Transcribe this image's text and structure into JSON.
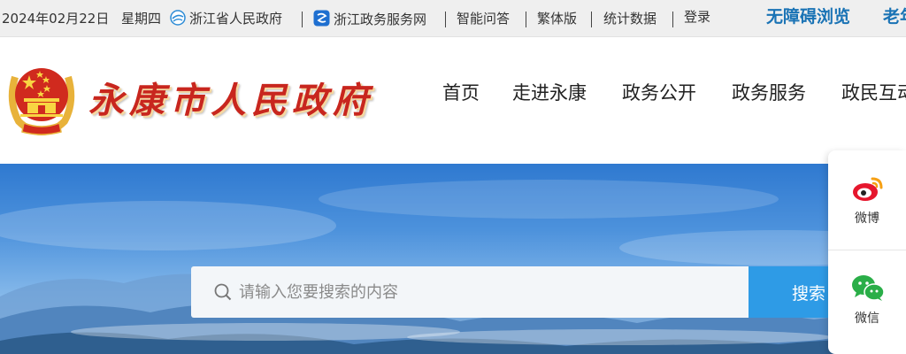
{
  "topbar": {
    "date": "2024年02月22日",
    "weekday": "星期四",
    "links": {
      "provincial_gov": "浙江省人民政府",
      "gov_service": "浙江政务服务网",
      "smart_qa": "智能问答",
      "traditional": "繁体版",
      "statistics": "统计数据",
      "login": "登录"
    },
    "accessibility": "无障碍浏览",
    "elderly_mode_partial": "老年"
  },
  "header": {
    "site_title": "永康市人民政府",
    "nav": [
      "首页",
      "走进永康",
      "政务公开",
      "政务服务",
      "政民互动"
    ]
  },
  "search": {
    "placeholder": "请输入您要搜索的内容",
    "button_label": "搜索"
  },
  "side_panel": {
    "weibo_label": "微博",
    "wechat_label": "微信"
  },
  "colors": {
    "topbar_bg": "#efefef",
    "accent_blue": "#1a73b5",
    "search_button": "#2e9be6",
    "title_red": "#c8261e"
  },
  "icons": {
    "province_link": "province-globe-icon",
    "service_link": "service-network-icon",
    "search": "search-icon",
    "weibo": "weibo-icon",
    "wechat": "wechat-icon",
    "emblem": "national-emblem"
  }
}
